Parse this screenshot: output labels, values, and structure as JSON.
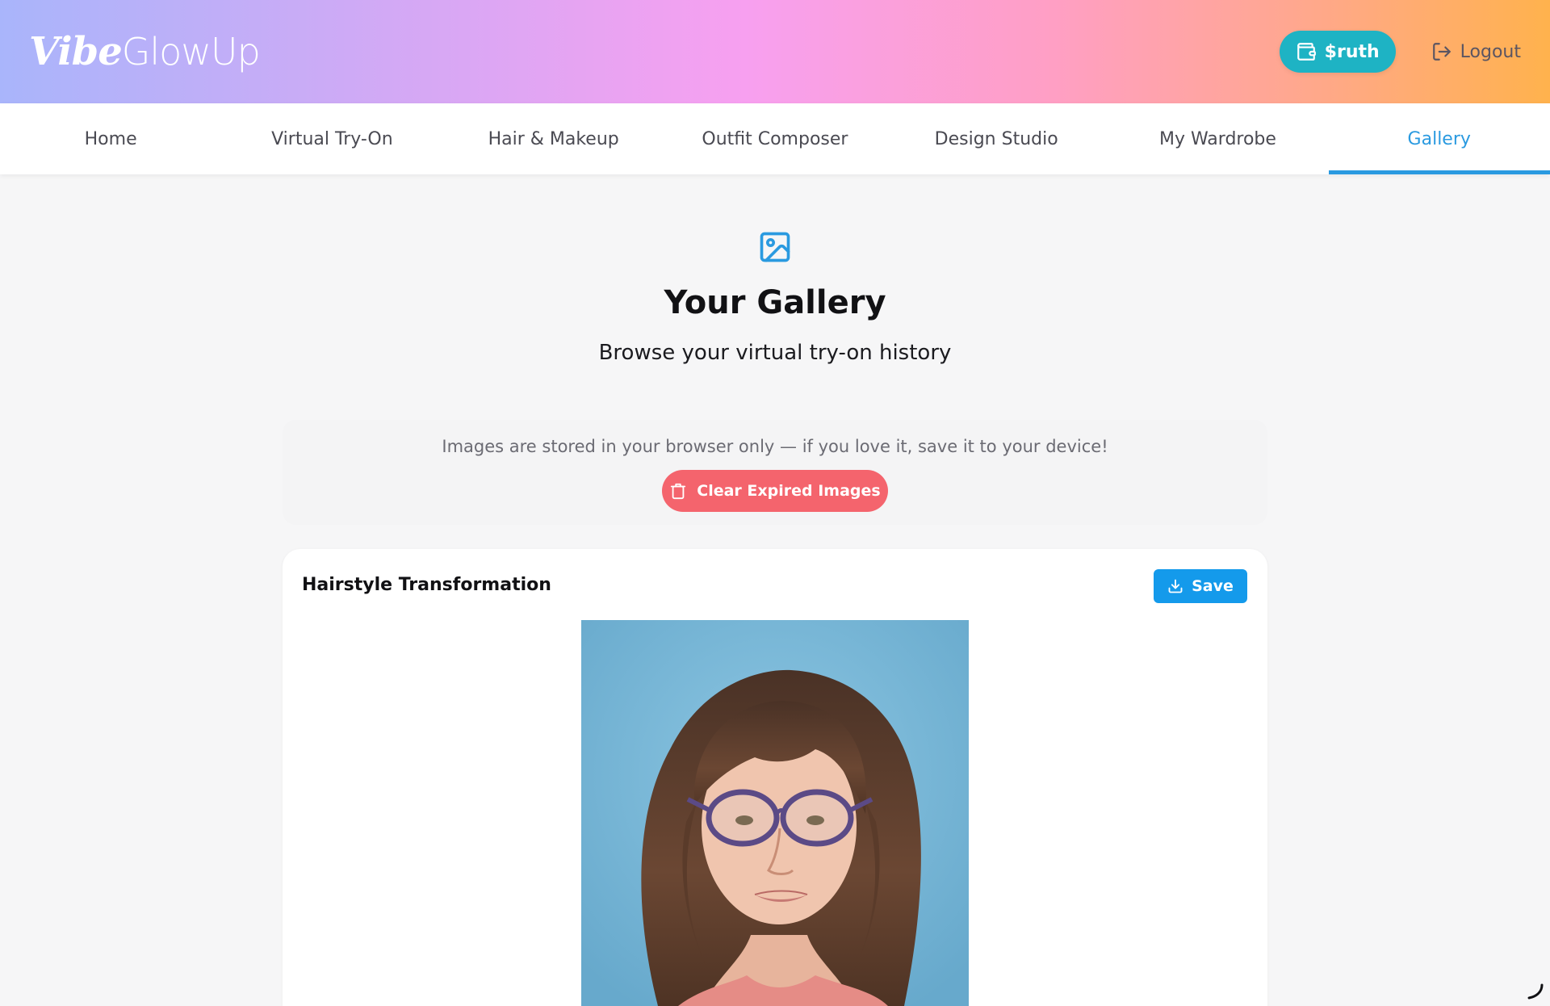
{
  "header": {
    "logo_part1": "Vibe",
    "logo_part2": "GlowUp",
    "wallet_label": "$ruth",
    "wallet_icon": "wallet-icon",
    "logout_label": "Logout",
    "logout_icon": "log-out-icon"
  },
  "nav": {
    "items": [
      {
        "label": "Home"
      },
      {
        "label": "Virtual Try-On"
      },
      {
        "label": "Hair & Makeup"
      },
      {
        "label": "Outfit Composer"
      },
      {
        "label": "Design Studio"
      },
      {
        "label": "My Wardrobe"
      },
      {
        "label": "Gallery",
        "active": true
      }
    ]
  },
  "page": {
    "icon": "image-icon",
    "title": "Your Gallery",
    "subtitle": "Browse your virtual try-on history"
  },
  "notice": {
    "text": "Images are stored in your browser only — if you love it, save it to your device!",
    "clear_button_label": "Clear Expired Images",
    "clear_button_icon": "trash-icon"
  },
  "gallery": {
    "items": [
      {
        "title": "Hairstyle Transformation",
        "save_label": "Save",
        "save_icon": "download-icon"
      }
    ]
  },
  "colors": {
    "accent": "#2a9ae0",
    "wallet_button": "#1eb3c4",
    "clear_button": "#f4646d",
    "save_button": "#149aeb"
  }
}
